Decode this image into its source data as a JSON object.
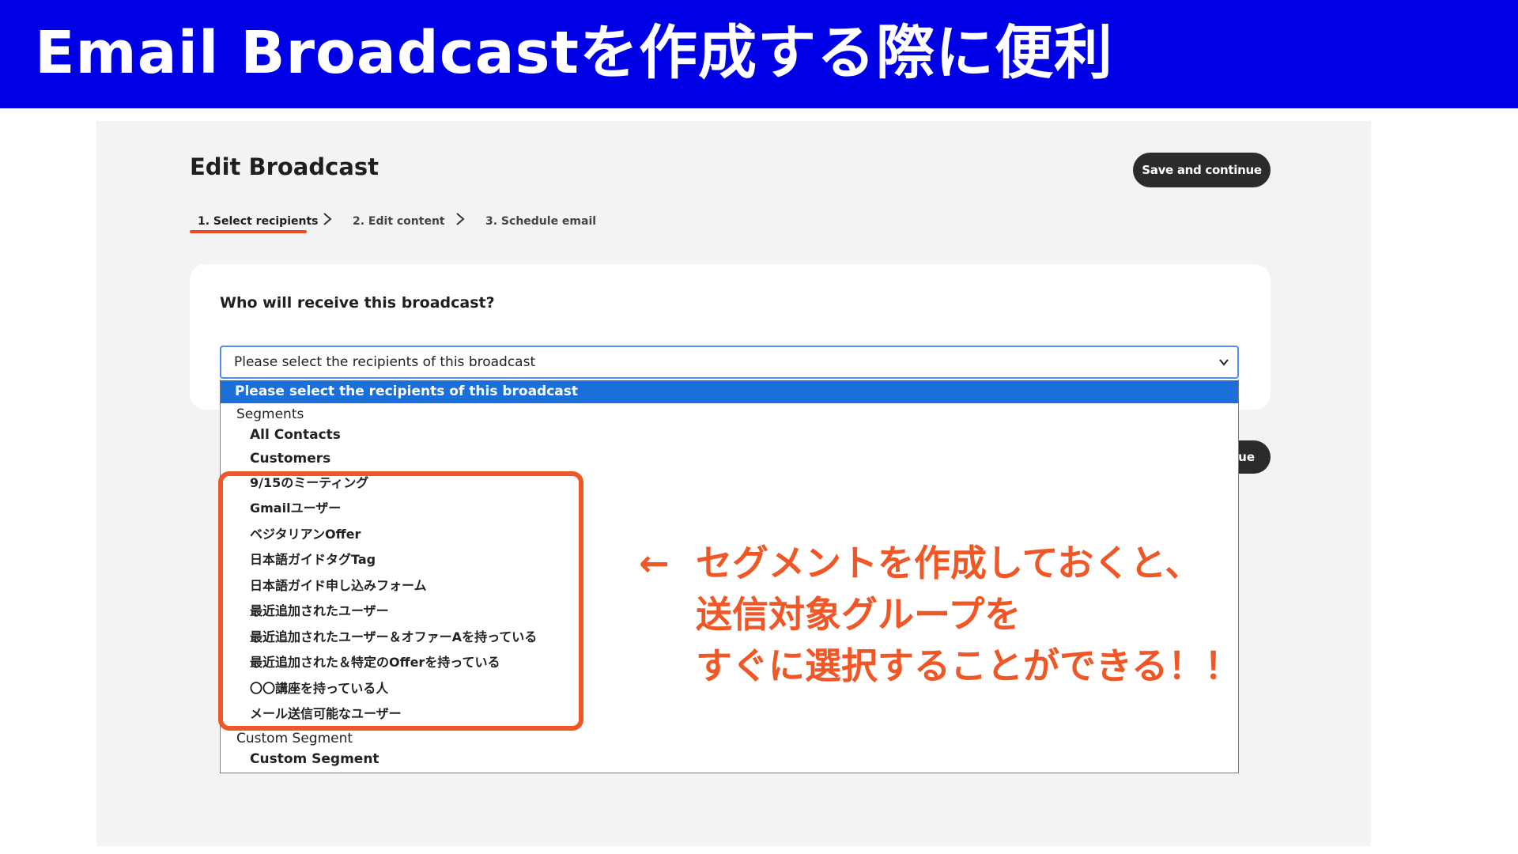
{
  "banner": {
    "title": "Email Broadcastを作成する際に便利"
  },
  "page": {
    "title": "Edit Broadcast",
    "save_button": "Save and continue",
    "save_button_partial": "ue"
  },
  "stepper": {
    "steps": [
      {
        "label": "1. Select recipients",
        "active": true
      },
      {
        "label": "2. Edit content",
        "active": false
      },
      {
        "label": "3. Schedule email",
        "active": false
      }
    ]
  },
  "recipients": {
    "question": "Who will receive this broadcast?",
    "select_value": "Please select the recipients of this broadcast",
    "options": {
      "selected": "Please select the recipients of this broadcast",
      "group_segments": "Segments",
      "segments": [
        "All Contacts",
        "Customers",
        "9/15のミーティング",
        "Gmailユーザー",
        "ベジタリアンOffer",
        "日本語ガイドタグTag",
        "日本語ガイド申し込みフォーム",
        "最近追加されたユーザー",
        "最近追加されたユーザー＆オファーAを持っている",
        "最近追加された＆特定のOfferを持っている",
        "〇〇講座を持っている人",
        "メール送信可能なユーザー"
      ],
      "group_custom": "Custom Segment",
      "custom": [
        "Custom Segment"
      ]
    }
  },
  "callout": {
    "arrow": "←",
    "lines": [
      "セグメントを作成しておくと、",
      "送信対象グループを",
      "すぐに選択することができる！！"
    ]
  },
  "colors": {
    "banner": "#0000e6",
    "accent": "#ef5726",
    "selected_option": "#1a6fd8",
    "button_dark": "#2b2b2b"
  }
}
